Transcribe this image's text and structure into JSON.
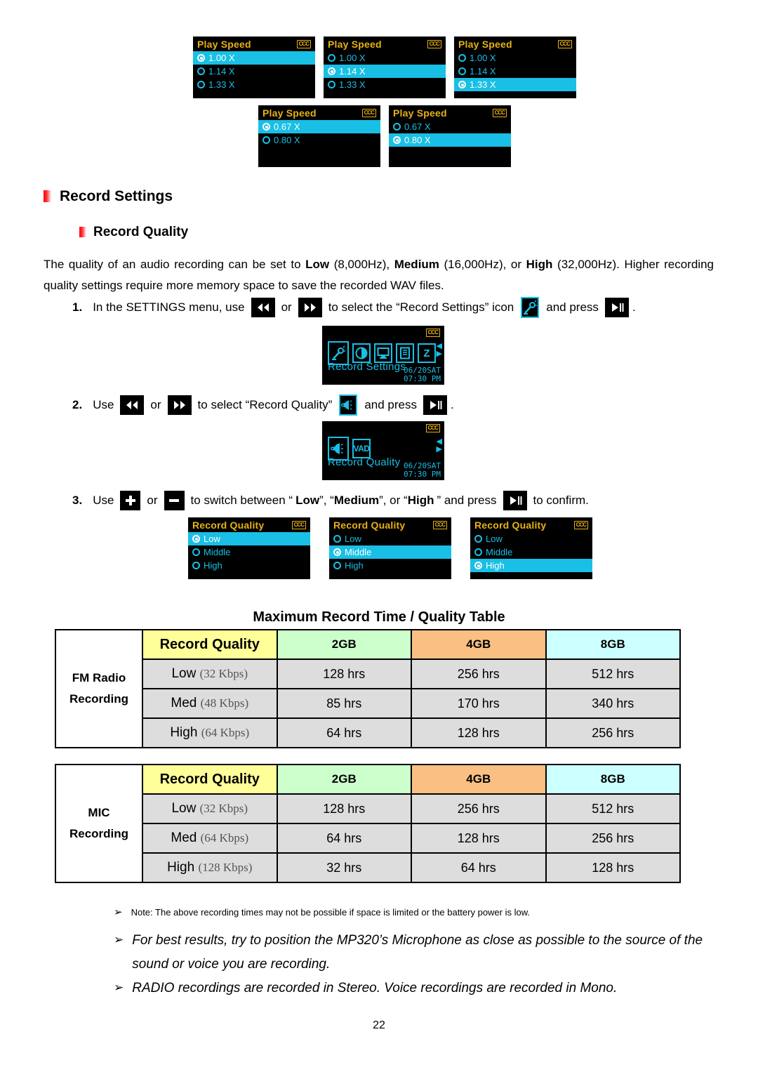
{
  "play_speed_screens": [
    {
      "title": "Play Speed",
      "badge": "CCC",
      "options": [
        {
          "label": "1.00 X",
          "selected": true
        },
        {
          "label": "1.14 X",
          "selected": false
        },
        {
          "label": "1.33 X",
          "selected": false
        }
      ]
    },
    {
      "title": "Play Speed",
      "badge": "CCC",
      "options": [
        {
          "label": "1.00 X",
          "selected": false
        },
        {
          "label": "1.14 X",
          "selected": true
        },
        {
          "label": "1.33 X",
          "selected": false
        }
      ]
    },
    {
      "title": "Play Speed",
      "badge": "CCC",
      "options": [
        {
          "label": "1.00 X",
          "selected": false
        },
        {
          "label": "1.14 X",
          "selected": false
        },
        {
          "label": "1.33 X",
          "selected": true
        }
      ]
    },
    {
      "title": "Play Speed",
      "badge": "CCC",
      "options": [
        {
          "label": "0.67 X",
          "selected": true
        },
        {
          "label": "0.80 X",
          "selected": false
        }
      ]
    },
    {
      "title": "Play Speed",
      "badge": "CCC",
      "options": [
        {
          "label": "0.67 X",
          "selected": false
        },
        {
          "label": "0.80 X",
          "selected": true
        }
      ]
    }
  ],
  "headings": {
    "section": "Record Settings",
    "subsection": "Record Quality"
  },
  "intro": {
    "part1": "The quality of an audio recording can be set to ",
    "low": "Low",
    "low_hz": " (8,000Hz), ",
    "medium": "Medium",
    "medium_hz": " (16,000Hz), or ",
    "high": "High",
    "high_hz": " (32,000Hz). Higher recording quality settings require more memory space to save the recorded WAV files."
  },
  "steps": [
    {
      "num": "1.",
      "t1": "In the SETTINGS menu, use",
      "t2": "or",
      "t3": "to select the “Record Settings” icon",
      "t4": "and press",
      "t5": "."
    },
    {
      "num": "2.",
      "t1": "Use",
      "t2": "or",
      "t3": "to select “Record Quality”",
      "t4": "and press",
      "t5": "."
    },
    {
      "num": "3.",
      "t1": "Use",
      "t2": "or",
      "t3": "to switch between “",
      "low": "Low",
      "t4": "”, “",
      "medium": "Medium",
      "t5": "”, or “",
      "high": "High",
      "t6": "” and press",
      "t7": "to confirm."
    }
  ],
  "menu_screens": [
    {
      "badge": "CCC",
      "label": "Record Settings",
      "date": "06/20",
      "day": "SAT",
      "time": "07:30 PM",
      "icons": [
        "mic-icon",
        "contrast-icon",
        "monitor-icon",
        "file-icon",
        "sleep-z-icon"
      ]
    },
    {
      "badge": "CCC",
      "label": "Record Quality",
      "date": "06/20",
      "day": "SAT",
      "time": "07:30 PM",
      "icons": [
        "speaker-icon",
        "vad-icon"
      ]
    }
  ],
  "quality_screens": [
    {
      "title": "Record Quality",
      "badge": "CCC",
      "options": [
        {
          "label": "Low",
          "selected": true
        },
        {
          "label": "Middle",
          "selected": false
        },
        {
          "label": "High",
          "selected": false
        }
      ]
    },
    {
      "title": "Record Quality",
      "badge": "CCC",
      "options": [
        {
          "label": "Low",
          "selected": false
        },
        {
          "label": "Middle",
          "selected": true
        },
        {
          "label": "High",
          "selected": false
        }
      ]
    },
    {
      "title": "Record Quality",
      "badge": "CCC",
      "options": [
        {
          "label": "Low",
          "selected": false
        },
        {
          "label": "Middle",
          "selected": false
        },
        {
          "label": "High",
          "selected": true
        }
      ]
    }
  ],
  "table_title": "Maximum Record Time / Quality Table",
  "tables": [
    {
      "row_head_line1": "FM Radio",
      "row_head_line2": "Recording",
      "headers": [
        "Record Quality",
        "2GB",
        "4GB",
        "8GB"
      ],
      "rows": [
        {
          "quality": "Low",
          "bitrate": "(32 Kbps)",
          "values": [
            "128 hrs",
            "256 hrs",
            "512 hrs"
          ]
        },
        {
          "quality": "Med",
          "bitrate": "(48 Kbps)",
          "values": [
            "85 hrs",
            "170 hrs",
            "340 hrs"
          ]
        },
        {
          "quality": "High",
          "bitrate": "(64 Kbps)",
          "values": [
            "64 hrs",
            "128 hrs",
            "256 hrs"
          ]
        }
      ]
    },
    {
      "row_head_line1": "MIC",
      "row_head_line2": "Recording",
      "headers": [
        "Record Quality",
        "2GB",
        "4GB",
        "8GB"
      ],
      "rows": [
        {
          "quality": "Low",
          "bitrate": "(32 Kbps)",
          "values": [
            "128 hrs",
            "256 hrs",
            "512 hrs"
          ]
        },
        {
          "quality": "Med",
          "bitrate": "(64 Kbps)",
          "values": [
            "64 hrs",
            "128 hrs",
            "256 hrs"
          ]
        },
        {
          "quality": "High",
          "bitrate": "(128 Kbps)",
          "values": [
            "32 hrs",
            "64 hrs",
            "128 hrs"
          ]
        }
      ]
    }
  ],
  "notes": [
    "Note: The above recording times may not be possible if space is limited or the battery power is low.",
    "For best results, try to position the MP320’s Microphone as close as possible to the source of the sound or voice you are recording.",
    "RADIO recordings are recorded in Stereo. Voice recordings are recorded in Mono."
  ],
  "page_number": "22",
  "colors": {
    "lcd_background": "#000000",
    "lcd_title": "#e8b114",
    "lcd_accent": "#19bfe5",
    "bullet_red": "#ff0000",
    "header_quality": "#ffff99",
    "header_2gb": "#ccffcc",
    "header_4gb": "#f9bf83",
    "header_8gb": "#ccffff",
    "data_cell": "#dddddd"
  }
}
